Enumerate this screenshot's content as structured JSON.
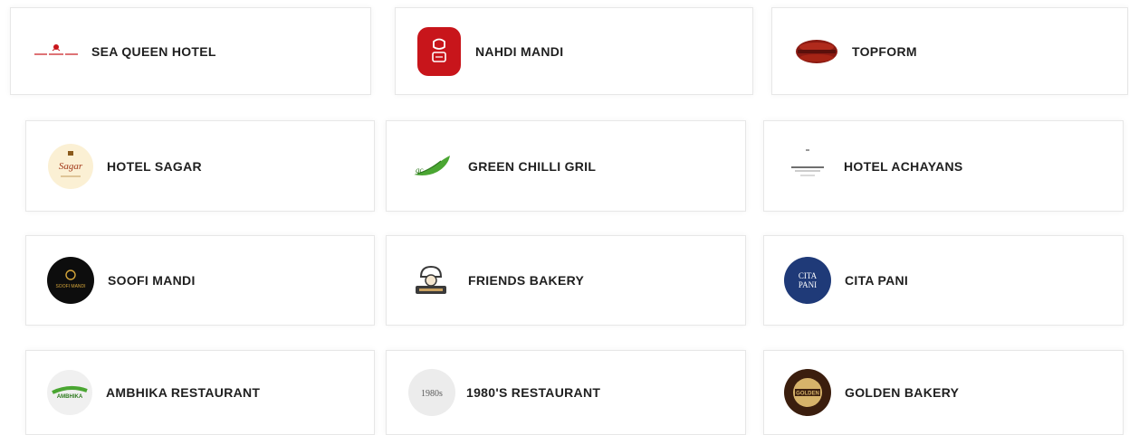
{
  "clients": [
    {
      "name": "SEA QUEEN HOTEL",
      "logo_icon": "sea-queen-hotel-logo-icon"
    },
    {
      "name": "NAHDI MANDI",
      "logo_icon": "nahdi-mandi-logo-icon"
    },
    {
      "name": "TOPFORM",
      "logo_icon": "topform-logo-icon"
    },
    {
      "name": "HOTEL SAGAR",
      "logo_icon": "hotel-sagar-logo-icon"
    },
    {
      "name": "GREEN CHILLI GRIL",
      "logo_icon": "green-chilli-logo-icon"
    },
    {
      "name": "HOTEL ACHAYANS",
      "logo_icon": "hotel-achayans-logo-icon"
    },
    {
      "name": "SOOFI MANDI",
      "logo_icon": "soofi-mandi-logo-icon"
    },
    {
      "name": "FRIENDS BAKERY",
      "logo_icon": "friends-bakery-logo-icon"
    },
    {
      "name": "CITA PANI",
      "logo_icon": "cita-pani-logo-icon"
    },
    {
      "name": "AMBHIKA RESTAURANT",
      "logo_icon": "ambhika-restaurant-logo-icon"
    },
    {
      "name": "1980'S RESTAURANT",
      "logo_icon": "1980s-restaurant-logo-icon"
    },
    {
      "name": "GOLDEN BAKERY",
      "logo_icon": "golden-bakery-logo-icon"
    }
  ],
  "logo_text": {
    "hotel_sagar": "Sagar",
    "soofi_mandi": "SOOFI MANDI",
    "cita_pani_line1": "CITA",
    "cita_pani_line2": "PANI",
    "ambhika": "AMBHIKA",
    "restaurant_1980s": "1980s",
    "golden_bakery": "GOLDEN"
  },
  "colors": {
    "card_border": "#e7e7e7",
    "text": "#1f1f1f",
    "nahdi_red": "#c8151b",
    "cita_navy": "#1f3a78",
    "golden_brown": "#3b1e0e",
    "green": "#4aa632"
  }
}
